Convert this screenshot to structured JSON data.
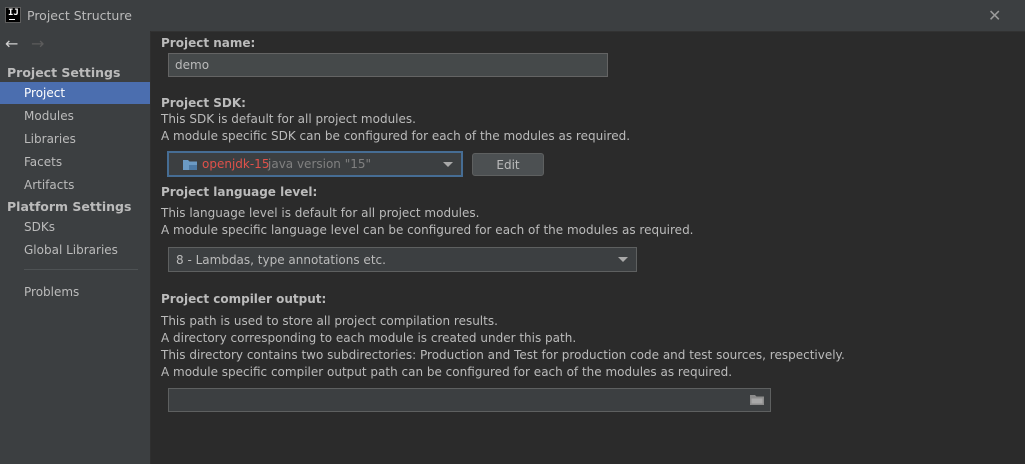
{
  "window": {
    "title": "Project Structure",
    "app_icon_text": "IJ"
  },
  "sidebar": {
    "project_settings_heading": "Project Settings",
    "project_settings_items": [
      "Project",
      "Modules",
      "Libraries",
      "Facets",
      "Artifacts"
    ],
    "platform_settings_heading": "Platform Settings",
    "platform_settings_items": [
      "SDKs",
      "Global Libraries"
    ],
    "problems_label": "Problems",
    "selected": "Project"
  },
  "project_name": {
    "label": "Project name:",
    "value": "demo"
  },
  "project_sdk": {
    "label": "Project SDK:",
    "desc_line1": "This SDK is default for all project modules.",
    "desc_line2": "A module specific SDK can be configured for each of the modules as required.",
    "sdk_name": "openjdk-15",
    "sdk_version": "java version \"15\"",
    "edit_label": "Edit"
  },
  "language_level": {
    "label": "Project language level:",
    "desc_line1": "This language level is default for all project modules.",
    "desc_line2": "A module specific language level can be configured for each of the modules as required.",
    "value": "8 - Lambdas, type annotations etc."
  },
  "compiler_output": {
    "label": "Project compiler output:",
    "desc_line1": "This path is used to store all project compilation results.",
    "desc_line2": "A directory corresponding to each module is created under this path.",
    "desc_line3": "This directory contains two subdirectories: Production and Test for production code and test sources, respectively.",
    "desc_line4": "A module specific compiler output path can be configured for each of the modules as required.",
    "value": ""
  },
  "colors": {
    "accent_selection": "#4b6eaf",
    "sdk_name": "#e0514a",
    "folder_icon": "#6b9ac4"
  }
}
